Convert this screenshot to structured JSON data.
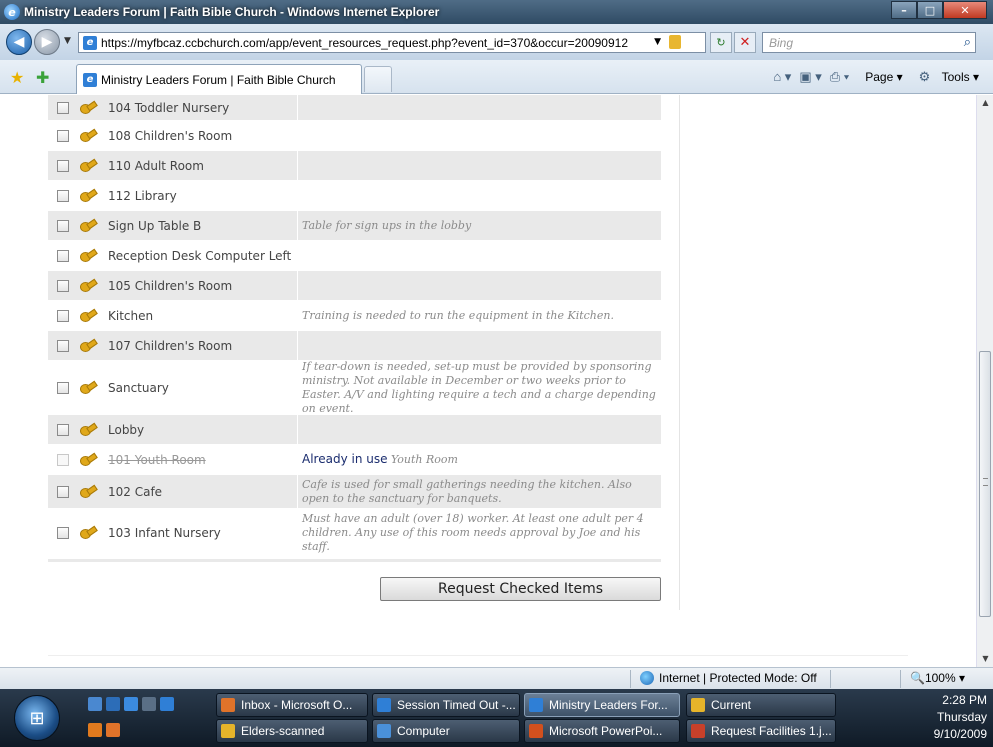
{
  "window": {
    "title": "Ministry Leaders Forum | Faith Bible Church - Windows Internet Explorer"
  },
  "address_bar": {
    "url": "https://myfbcaz.ccbchurch.com/app/event_resources_request.php?event_id=370&occur=20090912",
    "search_placeholder": "Bing"
  },
  "tab": {
    "label": "Ministry Leaders Forum | Faith Bible Church"
  },
  "command_bar": {
    "page_label": "Page",
    "tools_label": "Tools"
  },
  "resources": [
    {
      "name": "104 Toddler Nursery",
      "note": "",
      "disabled": false
    },
    {
      "name": "108 Children's Room",
      "note": "",
      "disabled": false
    },
    {
      "name": "110 Adult Room",
      "note": "",
      "disabled": false
    },
    {
      "name": "112 Library",
      "note": "",
      "disabled": false
    },
    {
      "name": "Sign Up Table B",
      "note": "Table for sign ups in the lobby",
      "disabled": false
    },
    {
      "name": "Reception Desk Computer Left",
      "note": "",
      "disabled": false
    },
    {
      "name": "105 Children's Room",
      "note": "",
      "disabled": false
    },
    {
      "name": "Kitchen",
      "note": "Training is needed to run the equipment in the Kitchen.",
      "disabled": false
    },
    {
      "name": "107 Children's Room",
      "note": "",
      "disabled": false
    },
    {
      "name": "Sanctuary",
      "note": "If tear-down is needed, set-up must be provided by sponsoring ministry. Not available in December or two weeks prior to Easter. A/V and lighting require a tech and a charge depending on event.",
      "disabled": false
    },
    {
      "name": "Lobby",
      "note": "",
      "disabled": false
    },
    {
      "name": "101 Youth Room",
      "note": "Youth Room",
      "status": "Already in use",
      "disabled": true
    },
    {
      "name": "102 Cafe",
      "note": "Cafe is used for small gatherings needing the kitchen. Also open to the sanctuary for banquets.",
      "disabled": false
    },
    {
      "name": "103 Infant Nursery",
      "note": "Must have an adult (over 18) worker. At least one adult per 4 children. Any use of this room needs approval by Joe and his staff.",
      "disabled": false
    }
  ],
  "request_button_label": "Request Checked Items",
  "status_bar": {
    "zone": "Internet | Protected Mode: Off",
    "zoom": "100%"
  },
  "taskbar": {
    "buttons": [
      {
        "label": "Inbox - Microsoft O...",
        "color": "#e0732a"
      },
      {
        "label": "Session Timed Out -...",
        "color": "#2f7fd6"
      },
      {
        "label": "Ministry Leaders For...",
        "color": "#2f7fd6"
      },
      {
        "label": "Current",
        "color": "#e6b42a"
      },
      {
        "label": "Elders-scanned",
        "color": "#e6b42a"
      },
      {
        "label": "Computer",
        "color": "#4a90d9"
      },
      {
        "label": "Microsoft PowerPoi...",
        "color": "#d2501e"
      },
      {
        "label": "Request Facilities 1.j...",
        "color": "#c8402a"
      }
    ],
    "clock": {
      "time": "2:28 PM",
      "day": "Thursday",
      "date": "9/10/2009"
    }
  }
}
